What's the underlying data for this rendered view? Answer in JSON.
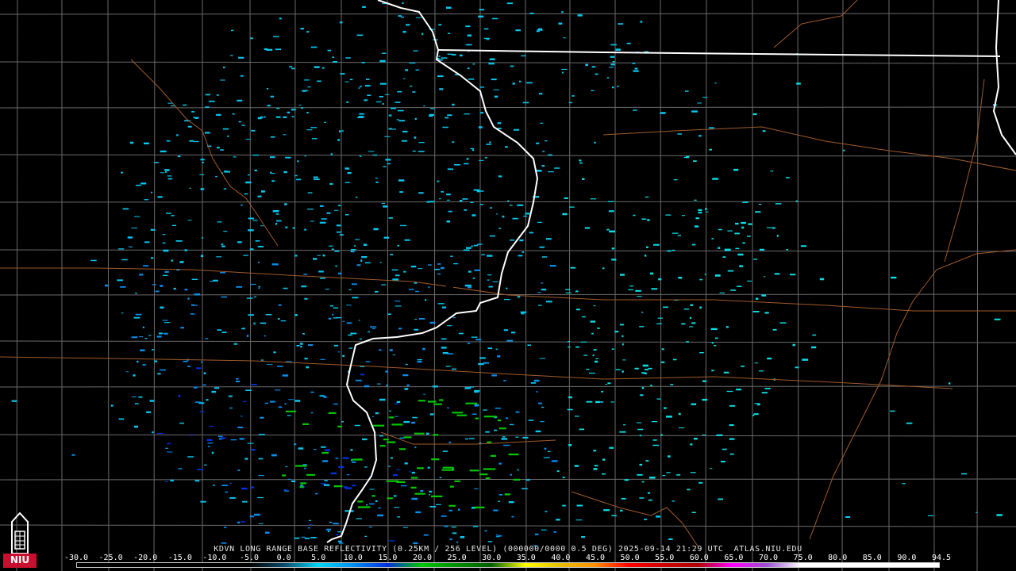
{
  "station": "KDVN",
  "product_caption": "KDVN LONG RANGE BASE REFLECTIVITY (0.25KM / 256 LEVEL) (000000/0000 0.5 DEG) 2025-09-14 21:29 UTC  ATLAS.NIU.EDU",
  "logo": {
    "label": "NIU",
    "primary_color": "#c8102e"
  },
  "colorbar": {
    "labels": [
      "-30.0",
      "-25.0",
      "-20.0",
      "-15.0",
      "-10.0",
      "-5.0",
      "0.0",
      "5.0",
      "10.0",
      "15.0",
      "20.0",
      "25.0",
      "30.0",
      "35.0",
      "40.0",
      "45.0",
      "50.0",
      "55.0",
      "60.0",
      "65.0",
      "70.0",
      "75.0",
      "80.0",
      "85.0",
      "90.0",
      "94.5"
    ],
    "colors": [
      "#000000",
      "#000000",
      "#000000",
      "#000000",
      "#000000",
      "#000000",
      "#0a4a6a",
      "#00d8f8",
      "#0090f0",
      "#0030e0",
      "#00c800",
      "#009000",
      "#006000",
      "#ffff00",
      "#e8c000",
      "#ff9000",
      "#ff0000",
      "#d00000",
      "#b00000",
      "#ff00ff",
      "#9a50d0",
      "#ffffff",
      "#ffffff",
      "#ffffff",
      "#ffffff",
      "#ffffff"
    ]
  },
  "map_colors": {
    "background": "#000000",
    "county_lines": "#6a6a6a",
    "roads": "#a05a2a",
    "state_lines": "#ffffff",
    "echo_light_cyan": "#00e0e8",
    "echo_cyan": "#00c8f0",
    "echo_blue": "#0090f0",
    "echo_dark_blue": "#0030e0",
    "echo_green": "#00c800"
  }
}
